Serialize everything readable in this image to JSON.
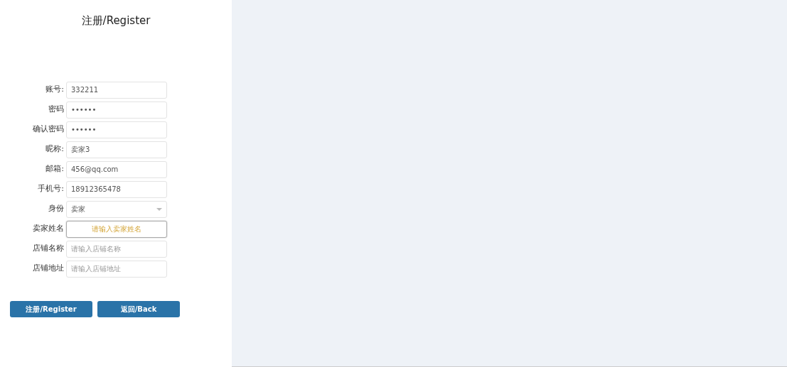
{
  "title": "注册/Register",
  "fields": [
    {
      "label": "账号:",
      "kind": "text",
      "value": "332211",
      "focused": false
    },
    {
      "label": "密码",
      "kind": "password",
      "value": "••••••",
      "focused": false
    },
    {
      "label": "确认密码",
      "kind": "password",
      "value": "••••••",
      "focused": false
    },
    {
      "label": "昵称:",
      "kind": "text",
      "value": "卖家3",
      "focused": false
    },
    {
      "label": "邮箱:",
      "kind": "text",
      "value": "456@qq.com",
      "focused": false
    },
    {
      "label": "手机号:",
      "kind": "text",
      "value": "18912365478",
      "focused": false
    },
    {
      "label": "身份",
      "kind": "select",
      "value": "卖家",
      "focused": false
    },
    {
      "label": "卖家姓名",
      "kind": "text",
      "placeholder": "请输入卖家姓名",
      "focused": true
    },
    {
      "label": "店铺名称",
      "kind": "text",
      "placeholder": "请输入店铺名称",
      "focused": false
    },
    {
      "label": "店铺地址",
      "kind": "text",
      "placeholder": "请输入店铺地址",
      "focused": false
    }
  ],
  "buttons": [
    "注册/Register",
    "返回/Back"
  ]
}
